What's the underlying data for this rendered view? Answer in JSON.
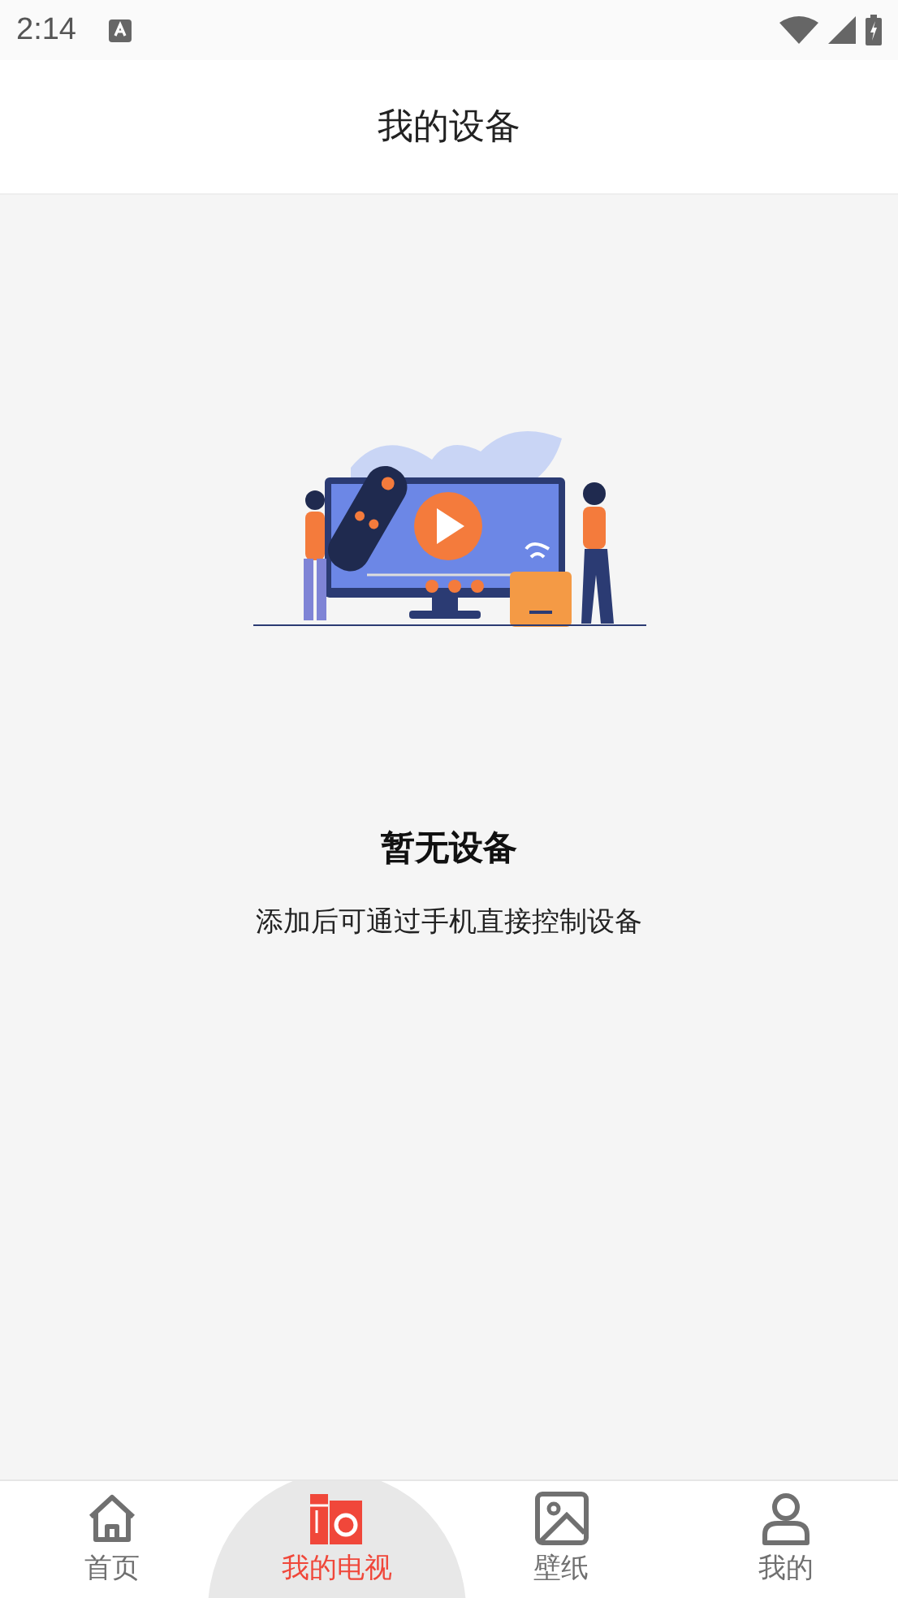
{
  "status_bar": {
    "time": "2:14"
  },
  "header": {
    "title": "我的设备"
  },
  "empty_state": {
    "title": "暂无设备",
    "message": "添加后可通过手机直接控制设备"
  },
  "tabs": [
    {
      "kind": "home",
      "label": "首页",
      "selected": false
    },
    {
      "kind": "tv",
      "label": "我的电视",
      "selected": true
    },
    {
      "kind": "wallpaper",
      "label": "壁纸",
      "selected": false
    },
    {
      "kind": "profile",
      "label": "我的",
      "selected": false
    }
  ]
}
